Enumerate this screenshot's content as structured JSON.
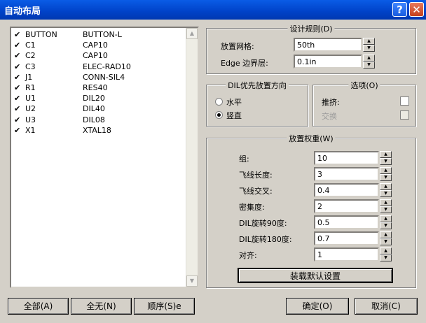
{
  "window": {
    "title": "自动布局",
    "help_label": "?",
    "close_label": "✕"
  },
  "components": [
    {
      "checked": true,
      "ref": "BUTTON",
      "footprint": "BUTTON-L"
    },
    {
      "checked": true,
      "ref": "C1",
      "footprint": "CAP10"
    },
    {
      "checked": true,
      "ref": "C2",
      "footprint": "CAP10"
    },
    {
      "checked": true,
      "ref": "C3",
      "footprint": "ELEC-RAD10"
    },
    {
      "checked": true,
      "ref": "J1",
      "footprint": "CONN-SIL4"
    },
    {
      "checked": true,
      "ref": "R1",
      "footprint": "RES40"
    },
    {
      "checked": true,
      "ref": "U1",
      "footprint": "DIL20"
    },
    {
      "checked": true,
      "ref": "U2",
      "footprint": "DIL40"
    },
    {
      "checked": true,
      "ref": "U3",
      "footprint": "DIL08"
    },
    {
      "checked": true,
      "ref": "X1",
      "footprint": "XTAL18"
    }
  ],
  "design_rules": {
    "title": "设计规则(D)",
    "grid_label": "放置网格:",
    "grid_value": "50th",
    "edge_label": "Edge 边界层:",
    "edge_value": "0.1in"
  },
  "dil_orientation": {
    "title": "DIL优先放置方向",
    "horizontal_label": "水平",
    "vertical_label": "竖直",
    "selected": "vertical"
  },
  "options": {
    "title": "选项(O)",
    "push_label": "推挤:",
    "swap_label": "交换"
  },
  "weights": {
    "title": "放置权重(W)",
    "rows": [
      {
        "label": "组:",
        "value": "10"
      },
      {
        "label": "飞线长度:",
        "value": "3"
      },
      {
        "label": "飞线交叉:",
        "value": "0.4"
      },
      {
        "label": "密集度:",
        "value": "2"
      },
      {
        "label": "DIL旋转90度:",
        "value": "0.5"
      },
      {
        "label": "DIL旋转180度:",
        "value": "0.7"
      },
      {
        "label": "对齐:",
        "value": "1"
      }
    ],
    "load_defaults_label": "装载默认设置"
  },
  "buttons": {
    "all": "全部(A)",
    "none": "全无(N)",
    "order": "顺序(S)e",
    "ok": "确定(O)",
    "cancel": "取消(C)"
  },
  "icons": {
    "check": "✔",
    "up": "▲",
    "down": "▼"
  }
}
